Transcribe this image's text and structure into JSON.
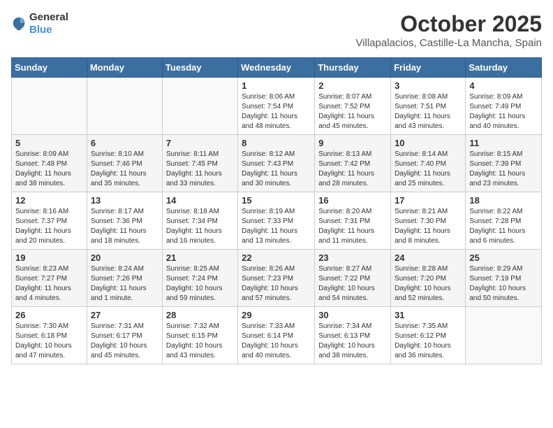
{
  "logo": {
    "general": "General",
    "blue": "Blue"
  },
  "title": "October 2025",
  "subtitle": "Villapalacios, Castille-La Mancha, Spain",
  "days_header": [
    "Sunday",
    "Monday",
    "Tuesday",
    "Wednesday",
    "Thursday",
    "Friday",
    "Saturday"
  ],
  "weeks": [
    [
      {
        "day": "",
        "info": ""
      },
      {
        "day": "",
        "info": ""
      },
      {
        "day": "",
        "info": ""
      },
      {
        "day": "1",
        "info": "Sunrise: 8:06 AM\nSunset: 7:54 PM\nDaylight: 11 hours\nand 48 minutes."
      },
      {
        "day": "2",
        "info": "Sunrise: 8:07 AM\nSunset: 7:52 PM\nDaylight: 11 hours\nand 45 minutes."
      },
      {
        "day": "3",
        "info": "Sunrise: 8:08 AM\nSunset: 7:51 PM\nDaylight: 11 hours\nand 43 minutes."
      },
      {
        "day": "4",
        "info": "Sunrise: 8:09 AM\nSunset: 7:49 PM\nDaylight: 11 hours\nand 40 minutes."
      }
    ],
    [
      {
        "day": "5",
        "info": "Sunrise: 8:09 AM\nSunset: 7:48 PM\nDaylight: 11 hours\nand 38 minutes."
      },
      {
        "day": "6",
        "info": "Sunrise: 8:10 AM\nSunset: 7:46 PM\nDaylight: 11 hours\nand 35 minutes."
      },
      {
        "day": "7",
        "info": "Sunrise: 8:11 AM\nSunset: 7:45 PM\nDaylight: 11 hours\nand 33 minutes."
      },
      {
        "day": "8",
        "info": "Sunrise: 8:12 AM\nSunset: 7:43 PM\nDaylight: 11 hours\nand 30 minutes."
      },
      {
        "day": "9",
        "info": "Sunrise: 8:13 AM\nSunset: 7:42 PM\nDaylight: 11 hours\nand 28 minutes."
      },
      {
        "day": "10",
        "info": "Sunrise: 8:14 AM\nSunset: 7:40 PM\nDaylight: 11 hours\nand 25 minutes."
      },
      {
        "day": "11",
        "info": "Sunrise: 8:15 AM\nSunset: 7:39 PM\nDaylight: 11 hours\nand 23 minutes."
      }
    ],
    [
      {
        "day": "12",
        "info": "Sunrise: 8:16 AM\nSunset: 7:37 PM\nDaylight: 11 hours\nand 20 minutes."
      },
      {
        "day": "13",
        "info": "Sunrise: 8:17 AM\nSunset: 7:36 PM\nDaylight: 11 hours\nand 18 minutes."
      },
      {
        "day": "14",
        "info": "Sunrise: 8:18 AM\nSunset: 7:34 PM\nDaylight: 11 hours\nand 16 minutes."
      },
      {
        "day": "15",
        "info": "Sunrise: 8:19 AM\nSunset: 7:33 PM\nDaylight: 11 hours\nand 13 minutes."
      },
      {
        "day": "16",
        "info": "Sunrise: 8:20 AM\nSunset: 7:31 PM\nDaylight: 11 hours\nand 11 minutes."
      },
      {
        "day": "17",
        "info": "Sunrise: 8:21 AM\nSunset: 7:30 PM\nDaylight: 11 hours\nand 8 minutes."
      },
      {
        "day": "18",
        "info": "Sunrise: 8:22 AM\nSunset: 7:28 PM\nDaylight: 11 hours\nand 6 minutes."
      }
    ],
    [
      {
        "day": "19",
        "info": "Sunrise: 8:23 AM\nSunset: 7:27 PM\nDaylight: 11 hours\nand 4 minutes."
      },
      {
        "day": "20",
        "info": "Sunrise: 8:24 AM\nSunset: 7:26 PM\nDaylight: 11 hours\nand 1 minute."
      },
      {
        "day": "21",
        "info": "Sunrise: 8:25 AM\nSunset: 7:24 PM\nDaylight: 10 hours\nand 59 minutes."
      },
      {
        "day": "22",
        "info": "Sunrise: 8:26 AM\nSunset: 7:23 PM\nDaylight: 10 hours\nand 57 minutes."
      },
      {
        "day": "23",
        "info": "Sunrise: 8:27 AM\nSunset: 7:22 PM\nDaylight: 10 hours\nand 54 minutes."
      },
      {
        "day": "24",
        "info": "Sunrise: 8:28 AM\nSunset: 7:20 PM\nDaylight: 10 hours\nand 52 minutes."
      },
      {
        "day": "25",
        "info": "Sunrise: 8:29 AM\nSunset: 7:19 PM\nDaylight: 10 hours\nand 50 minutes."
      }
    ],
    [
      {
        "day": "26",
        "info": "Sunrise: 7:30 AM\nSunset: 6:18 PM\nDaylight: 10 hours\nand 47 minutes."
      },
      {
        "day": "27",
        "info": "Sunrise: 7:31 AM\nSunset: 6:17 PM\nDaylight: 10 hours\nand 45 minutes."
      },
      {
        "day": "28",
        "info": "Sunrise: 7:32 AM\nSunset: 6:15 PM\nDaylight: 10 hours\nand 43 minutes."
      },
      {
        "day": "29",
        "info": "Sunrise: 7:33 AM\nSunset: 6:14 PM\nDaylight: 10 hours\nand 40 minutes."
      },
      {
        "day": "30",
        "info": "Sunrise: 7:34 AM\nSunset: 6:13 PM\nDaylight: 10 hours\nand 38 minutes."
      },
      {
        "day": "31",
        "info": "Sunrise: 7:35 AM\nSunset: 6:12 PM\nDaylight: 10 hours\nand 36 minutes."
      },
      {
        "day": "",
        "info": ""
      }
    ]
  ]
}
